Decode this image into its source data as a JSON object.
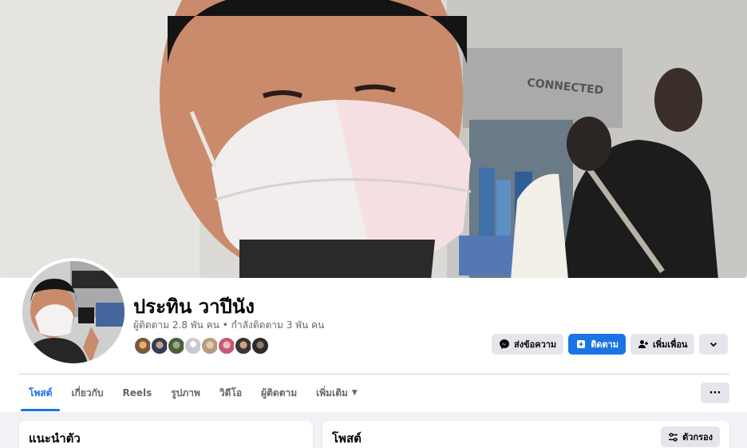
{
  "profile": {
    "name": "ประทิน วาปีนัง",
    "stats": "ผู้ติดตาม 2.8 พัน คน • กำลังติดตาม 3 พัน คน"
  },
  "cover": {
    "sign_text": "CONNECTED"
  },
  "friends": [
    "friend-1",
    "friend-2",
    "friend-3",
    "friend-4",
    "friend-5",
    "friend-6",
    "friend-7",
    "friend-8"
  ],
  "actions": {
    "message_label": "ส่งข้อความ",
    "follow_label": "ติดตาม",
    "add_friend_label": "เพิ่มเพื่อน"
  },
  "tabs": [
    {
      "label": "โพสต์",
      "active": true
    },
    {
      "label": "เกี่ยวกับ",
      "active": false
    },
    {
      "label": "Reels",
      "active": false
    },
    {
      "label": "รูปภาพ",
      "active": false
    },
    {
      "label": "วิดีโอ",
      "active": false
    },
    {
      "label": "ผู้ติดตาม",
      "active": false
    },
    {
      "label": "เพิ่มเติม",
      "active": false
    }
  ],
  "more_tabs_label": "···",
  "intro_card": {
    "title": "แนะนำตัว"
  },
  "posts_card": {
    "title": "โพสต์",
    "filter_label": "ตัวกรอง"
  },
  "colors": {
    "accent": "#1b74e4",
    "secondary_button": "#e4e6eb",
    "page_background": "#f0f2f5",
    "secondary_text": "#65676b"
  },
  "icons": {
    "message": "messenger-icon",
    "follow": "follow-plus-icon",
    "add_friend": "add-person-icon",
    "dropdown": "chevron-down-icon",
    "filter": "filter-sliders-icon"
  }
}
